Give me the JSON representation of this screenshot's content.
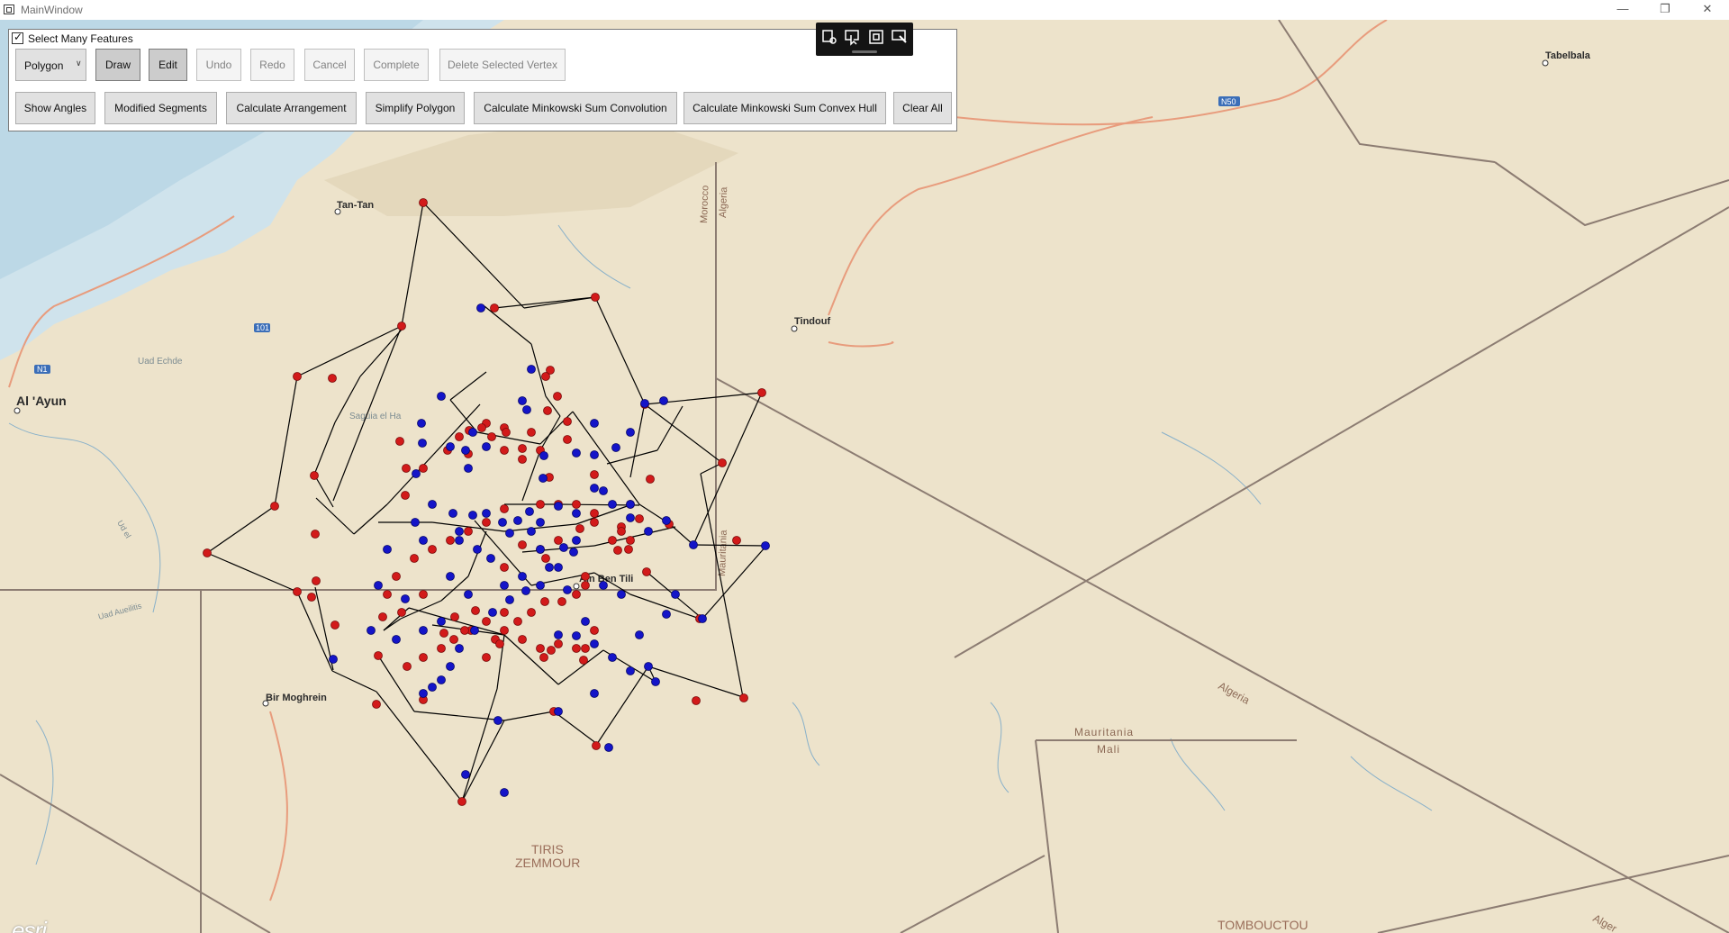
{
  "window": {
    "title": "MainWindow",
    "minimize_glyph": "—",
    "maximize_glyph": "❐",
    "close_glyph": "✕"
  },
  "panel": {
    "checkbox_label": "Select Many Features",
    "checkbox_checked": true,
    "geometry_select": "Polygon",
    "row1": [
      {
        "id": "draw",
        "label": "Draw",
        "state": "pressed"
      },
      {
        "id": "edit",
        "label": "Edit",
        "state": "pressed"
      },
      {
        "id": "undo",
        "label": "Undo",
        "state": "disabled"
      },
      {
        "id": "redo",
        "label": "Redo",
        "state": "disabled"
      },
      {
        "id": "cancel",
        "label": "Cancel",
        "state": "disabled"
      },
      {
        "id": "complete",
        "label": "Complete",
        "state": "disabled"
      },
      {
        "id": "delete-vertex",
        "label": "Delete Selected Vertex",
        "state": "disabled"
      }
    ],
    "row2": [
      {
        "id": "show-angles",
        "label": "Show Angles"
      },
      {
        "id": "modified-segments",
        "label": "Modified Segments"
      },
      {
        "id": "calculate-arrangement",
        "label": "Calculate Arrangement"
      },
      {
        "id": "simplify-polygon",
        "label": "Simplify Polygon"
      },
      {
        "id": "minkowski-convolution",
        "label": "Calculate Minkowski Sum Convolution"
      },
      {
        "id": "minkowski-convex-hull",
        "label": "Calculate Minkowski Sum Convex Hull"
      },
      {
        "id": "clear-all",
        "label": "Clear All"
      }
    ]
  },
  "mini_toolbar": {
    "icons": [
      "settings-edit-icon",
      "select-arrow-icon",
      "fullscreen-icon",
      "edit-selection-icon"
    ]
  },
  "map": {
    "labels": {
      "tabelbala": "Tabelbala",
      "n50": "N50",
      "tan_tan": "Tan-Tan",
      "morocco": "Morocco",
      "algeria_top": "Algeria",
      "n101": "101",
      "tindouf": "Tindouf",
      "n1": "N1",
      "al_ayun": "Al 'Ayun",
      "uad_echde": "Uad Echde",
      "saguia": "Saguia el Ha",
      "ain_ben_tili": "Ain Ben Tili",
      "mauritania_vert": "Mauritania",
      "bir_moghrein": "Bir Moghrein",
      "algeria_diag": "Algeria",
      "mauritania": "Mauritania",
      "mali": "Mali",
      "tiris": "TIRIS",
      "zemmour": "ZEMMOUR",
      "tombouctou": "TOMBOUCTOU",
      "algeria_br": "Alger",
      "ud_el": "Ud el",
      "uad_aueilitis": "Uad Aueilitis"
    },
    "point_colors": {
      "red": "#d21a1a",
      "blue": "#1414c8"
    },
    "attribution": "esri"
  }
}
